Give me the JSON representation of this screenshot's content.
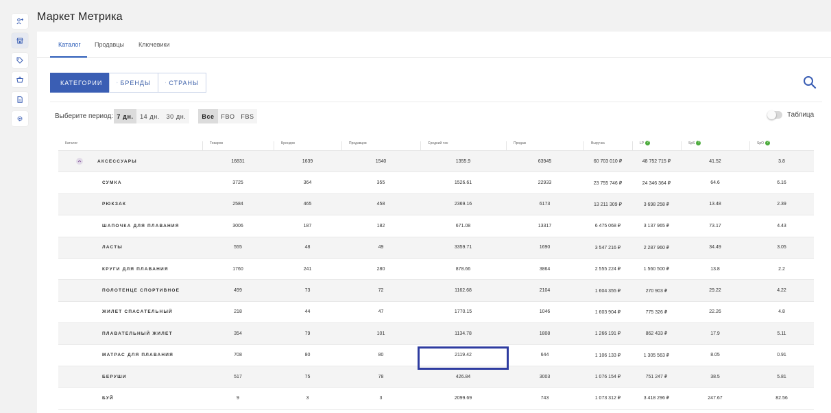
{
  "app": {
    "title": "Маркет Метрика"
  },
  "sidebar": {
    "items": [
      {
        "icon": "person-arrow-icon"
      },
      {
        "icon": "storefront-icon",
        "active": true
      },
      {
        "icon": "tag-icon"
      },
      {
        "icon": "basket-icon"
      },
      {
        "icon": "document-icon"
      },
      {
        "icon": "gear-icon"
      }
    ]
  },
  "tabs": [
    {
      "label": "Каталог",
      "active": true
    },
    {
      "label": "Продавцы"
    },
    {
      "label": "Ключевики"
    }
  ],
  "segments": [
    {
      "label": "КАТЕГОРИИ",
      "icon": "list-icon",
      "active": true
    },
    {
      "label": "БРЕНДЫ",
      "icon": "tag-icon"
    },
    {
      "label": "СТРАНЫ",
      "icon": "flag-icon"
    }
  ],
  "filters": {
    "period_label": "Выберите период:",
    "periods": [
      "7 дн.",
      "14 дн.",
      "30 дн."
    ],
    "selected_period": "7 дн.",
    "fulfillment": [
      "Все",
      "FBO",
      "FBS"
    ],
    "selected_fulfillment": "Все",
    "table_toggle_label": "Таблица"
  },
  "table": {
    "columns": [
      "Каталог",
      "Товаров",
      "Брендов",
      "Продавцов",
      "Средний чек",
      "Продаж",
      "Выручка",
      "LP",
      "SpS",
      "SpO"
    ],
    "rows": [
      {
        "name": "АКСЕССУАРЫ",
        "parent": true,
        "items": "16831",
        "brands": "1639",
        "sellers": "1540",
        "avg_check": "1355.9",
        "sales": "63945",
        "revenue": "60 703 010 ₽",
        "lp": "48 752 715 ₽",
        "sps": "41.52",
        "spo": "3.8"
      },
      {
        "name": "СУМКА",
        "items": "3725",
        "brands": "364",
        "sellers": "355",
        "avg_check": "1526.61",
        "sales": "22933",
        "revenue": "23 755 746 ₽",
        "lp": "24 346 364 ₽",
        "sps": "64.6",
        "spo": "6.16"
      },
      {
        "name": "РЮКЗАК",
        "items": "2584",
        "brands": "465",
        "sellers": "458",
        "avg_check": "2369.16",
        "sales": "6173",
        "revenue": "13 211 309 ₽",
        "lp": "3 698 258 ₽",
        "sps": "13.48",
        "spo": "2.39"
      },
      {
        "name": "ШАПОЧКА ДЛЯ ПЛАВАНИЯ",
        "items": "3006",
        "brands": "187",
        "sellers": "182",
        "avg_check": "671.08",
        "sales": "13317",
        "revenue": "6 475 068 ₽",
        "lp": "3 137 965 ₽",
        "sps": "73.17",
        "spo": "4.43"
      },
      {
        "name": "ЛАСТЫ",
        "items": "555",
        "brands": "48",
        "sellers": "49",
        "avg_check": "3359.71",
        "sales": "1690",
        "revenue": "3 547 216 ₽",
        "lp": "2 287 960 ₽",
        "sps": "34.49",
        "spo": "3.05"
      },
      {
        "name": "КРУГИ ДЛЯ ПЛАВАНИЯ",
        "items": "1760",
        "brands": "241",
        "sellers": "280",
        "avg_check": "878.66",
        "sales": "3864",
        "revenue": "2 555 224 ₽",
        "lp": "1 560 500 ₽",
        "sps": "13.8",
        "spo": "2.2"
      },
      {
        "name": "ПОЛОТЕНЦЕ СПОРТИВНОЕ",
        "items": "499",
        "brands": "73",
        "sellers": "72",
        "avg_check": "1162.68",
        "sales": "2104",
        "revenue": "1 604 355 ₽",
        "lp": "270 903 ₽",
        "sps": "29.22",
        "spo": "4.22"
      },
      {
        "name": "ЖИЛЕТ СПАСАТЕЛЬНЫЙ",
        "items": "218",
        "brands": "44",
        "sellers": "47",
        "avg_check": "1770.15",
        "sales": "1046",
        "revenue": "1 603 904 ₽",
        "lp": "775 326 ₽",
        "sps": "22.26",
        "spo": "4.8"
      },
      {
        "name": "ПЛАВАТЕЛЬНЫЙ ЖИЛЕТ",
        "items": "354",
        "brands": "79",
        "sellers": "101",
        "avg_check": "1134.78",
        "sales": "1808",
        "revenue": "1 266 191 ₽",
        "lp": "862 433 ₽",
        "sps": "17.9",
        "spo": "5.11"
      },
      {
        "name": "МАТРАС ДЛЯ ПЛАВАНИЯ",
        "items": "708",
        "brands": "80",
        "sellers": "80",
        "avg_check": "2119.42",
        "sales": "644",
        "revenue": "1 106 133 ₽",
        "lp": "1 305 563 ₽",
        "sps": "8.05",
        "spo": "0.91"
      },
      {
        "name": "БЕРУШИ",
        "items": "517",
        "brands": "75",
        "sellers": "78",
        "avg_check": "426.84",
        "sales": "3003",
        "revenue": "1 076 154 ₽",
        "lp": "751 247 ₽",
        "sps": "38.5",
        "spo": "5.81"
      },
      {
        "name": "БУЙ",
        "items": "9",
        "brands": "3",
        "sellers": "3",
        "avg_check": "2099.69",
        "sales": "743",
        "revenue": "1 073 312 ₽",
        "lp": "3 418 296 ₽",
        "sps": "247.67",
        "spo": "82.56"
      }
    ]
  },
  "colors": {
    "accent": "#3a5eb4",
    "highlight": "#2e3ca0",
    "help": "#4cab3c"
  }
}
